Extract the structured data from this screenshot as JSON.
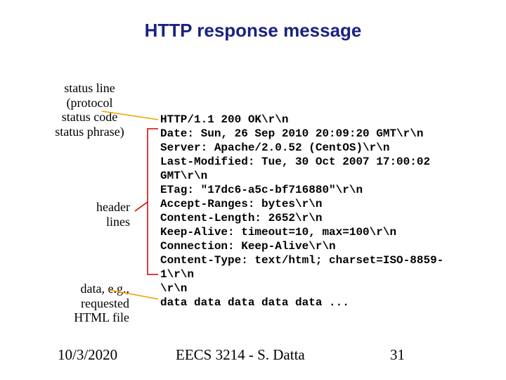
{
  "title": "HTTP response message",
  "labels": {
    "status": "status line\n(protocol\nstatus code\nstatus phrase)",
    "headers": "header\nlines",
    "data": "data, e.g.,\nrequested\nHTML file"
  },
  "code_lines": [
    "HTTP/1.1 200 OK\\r\\n",
    "Date: Sun, 26 Sep 2010 20:09:20 GMT\\r\\n",
    "Server: Apache/2.0.52 (CentOS)\\r\\n",
    "Last-Modified: Tue, 30 Oct 2007 17:00:02 GMT\\r\\n",
    "ETag: \"17dc6-a5c-bf716880\"\\r\\n",
    "Accept-Ranges: bytes\\r\\n",
    "Content-Length: 2652\\r\\n",
    "Keep-Alive: timeout=10, max=100\\r\\n",
    "Connection: Keep-Alive\\r\\n",
    "Content-Type: text/html; charset=ISO-8859-1\\r\\n",
    "\\r\\n",
    "data data data data data ..."
  ],
  "footer": {
    "date": "10/3/2020",
    "course": "EECS 3214 - S. Datta",
    "page": "31"
  }
}
